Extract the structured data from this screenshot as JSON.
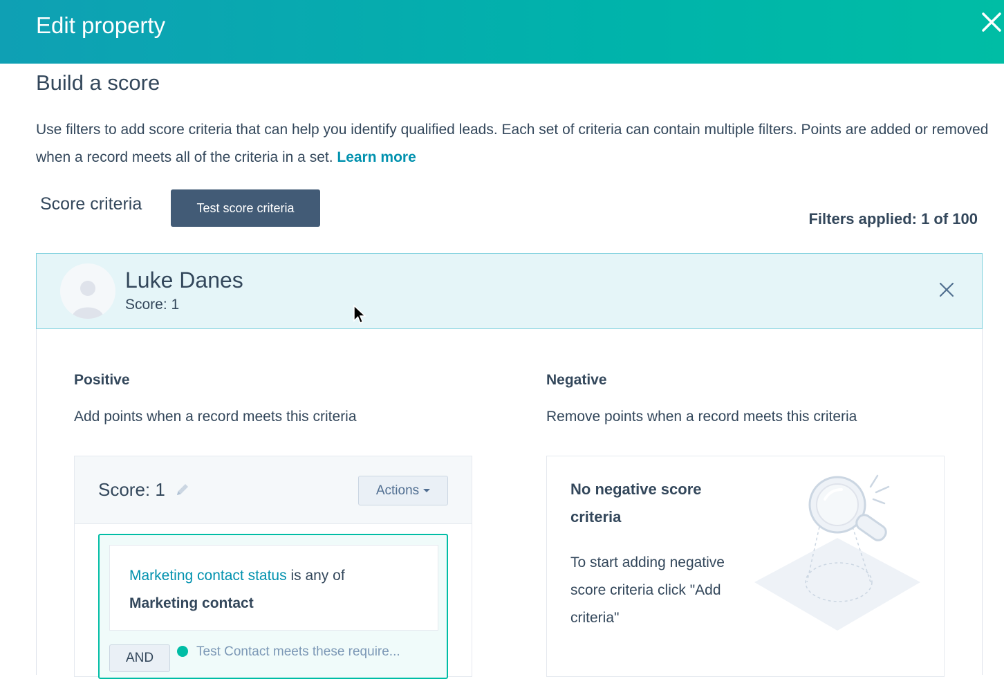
{
  "header": {
    "title": "Edit property",
    "close_icon": "close-icon"
  },
  "section": {
    "title": "Build a score",
    "intro": "Use filters to add score criteria that can help you identify qualified leads. Each set of criteria can contain multiple filters. Points are added or removed when a record meets all of the criteria in a set. ",
    "learn_more": "Learn more"
  },
  "criteria": {
    "label": "Score criteria",
    "test_button": "Test score criteria",
    "filters_applied": "Filters applied: 1 of 100"
  },
  "test_contact": {
    "name": "Luke Danes",
    "score": "Score: 1"
  },
  "positive": {
    "heading": "Positive",
    "description": "Add points when a record meets this criteria",
    "score_label": "Score: 1",
    "actions_label": "Actions",
    "filter": {
      "property": "Marketing contact status",
      "operator": " is any of",
      "value": "Marketing contact"
    },
    "and_label": "AND",
    "test_status": "Test Contact meets these require..."
  },
  "negative": {
    "heading": "Negative",
    "description": "Remove points when a record meets this criteria",
    "empty_title": "No negative score criteria",
    "empty_body": "To start adding negative score criteria click \"Add criteria\""
  },
  "colors": {
    "header_start": "#0fa0b4",
    "header_end": "#00bda5",
    "link": "#0091ae",
    "primary_button": "#425b76",
    "accent": "#00bda5"
  }
}
